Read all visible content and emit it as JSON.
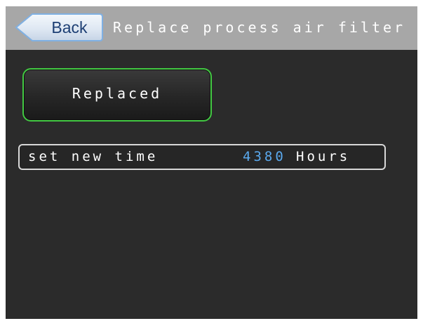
{
  "header": {
    "back_label": "Back",
    "title": "Replace process air filter"
  },
  "main": {
    "replaced_label": "Replaced",
    "time_setting": {
      "label": "set new time",
      "value": "4380",
      "unit": "Hours"
    }
  },
  "colors": {
    "background": "#2b2b2b",
    "header_bar": "#a7a7a7",
    "back_button": "#dfe8f3",
    "back_text": "#1d3f74",
    "button_border": "#42c842",
    "value_text": "#5aa9ee"
  }
}
